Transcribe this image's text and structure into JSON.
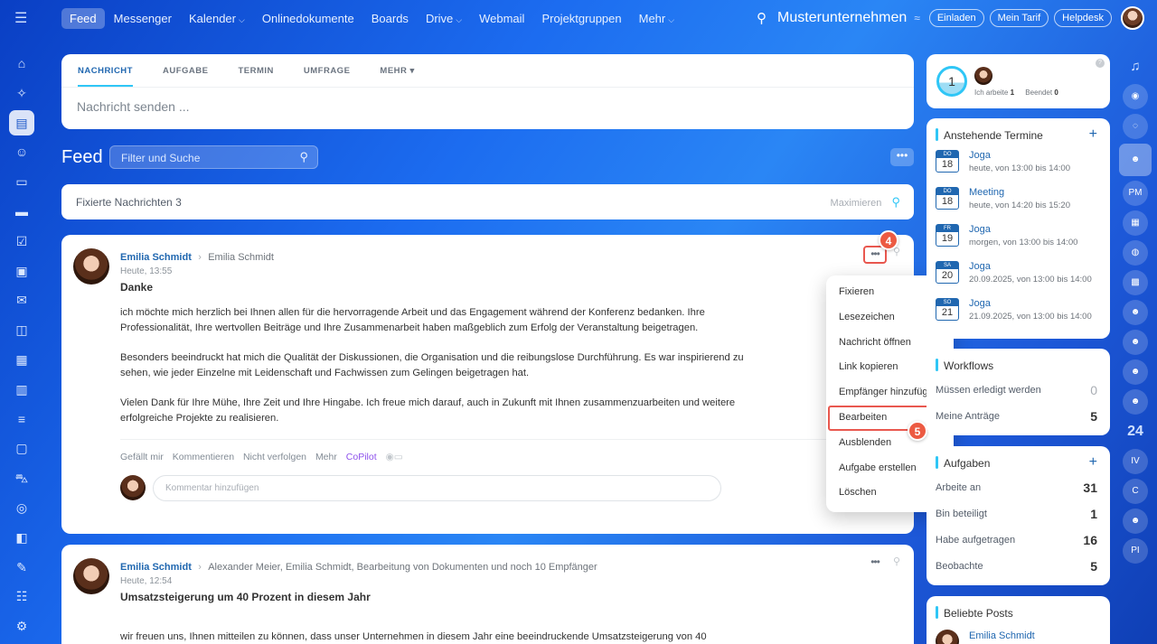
{
  "topbar": {
    "nav": [
      {
        "label": "Feed",
        "active": true,
        "caret": false
      },
      {
        "label": "Messenger",
        "active": false,
        "caret": false
      },
      {
        "label": "Kalender",
        "active": false,
        "caret": true
      },
      {
        "label": "Onlinedokumente",
        "active": false,
        "caret": false
      },
      {
        "label": "Boards",
        "active": false,
        "caret": false
      },
      {
        "label": "Drive",
        "active": false,
        "caret": true
      },
      {
        "label": "Webmail",
        "active": false,
        "caret": false
      },
      {
        "label": "Projektgruppen",
        "active": false,
        "caret": false
      },
      {
        "label": "Mehr",
        "active": false,
        "caret": true
      }
    ],
    "company": "Musterunternehmen",
    "buttons": {
      "invite": "Einladen",
      "plan": "Mein Tarif",
      "help": "Helpdesk"
    }
  },
  "composer": {
    "tabs": [
      "NACHRICHT",
      "AUFGABE",
      "TERMIN",
      "UMFRAGE",
      "MEHR"
    ],
    "placeholder": "Nachricht senden ..."
  },
  "feed": {
    "title": "Feed",
    "filter_placeholder": "Filter und Suche",
    "pinned": {
      "label": "Fixierte Nachrichten",
      "count": "3",
      "maximize": "Maximieren"
    }
  },
  "post1": {
    "author": "Emilia Schmidt",
    "recipients": "Emilia Schmidt",
    "time": "Heute, 13:55",
    "title": "Danke",
    "paragraphs": [
      "ich möchte mich herzlich bei Ihnen allen für die hervorragende Arbeit und das Engagement während der Konferenz bedanken. Ihre Professionalität, Ihre wertvollen Beiträge und Ihre Zusammenarbeit haben maßgeblich zum Erfolg der Veranstaltung beigetragen.",
      "Besonders beeindruckt hat mich die Qualität der Diskussionen, die Organisation und die reibungslose Durchführung. Es war inspirierend zu sehen, wie jeder Einzelne mit Leidenschaft und Fachwissen zum Gelingen beigetragen hat.",
      "Vielen Dank für Ihre Mühe, Ihre Zeit und Ihre Hingabe. Ich freue mich darauf, auch in Zukunft mit Ihnen zusammenzuarbeiten und weitere erfolgreiche Projekte zu realisieren."
    ],
    "actions": {
      "like": "Gefällt mir",
      "comment": "Kommentieren",
      "unfollow": "Nicht verfolgen",
      "more": "Mehr",
      "copilot": "CoPilot"
    },
    "comment_placeholder": "Kommentar hinzufügen"
  },
  "post2": {
    "author": "Emilia Schmidt",
    "recipients": "Alexander Meier, Emilia Schmidt, Bearbeitung von Dokumenten  und noch 10 Empfänger",
    "time": "Heute, 12:54",
    "title": "Umsatzsteigerung um 40 Prozent in diesem Jahr",
    "body_start": "wir freuen uns, Ihnen mitteilen zu können, dass unser Unternehmen in diesem Jahr eine beeindruckende Umsatzsteigerung von 40"
  },
  "badges": {
    "step4": "4",
    "step5": "5"
  },
  "context_menu": [
    "Fixieren",
    "Lesezeichen",
    "Nachricht öffnen",
    "Link kopieren",
    "Empfänger hinzufügen",
    "Bearbeiten",
    "Ausblenden",
    "Aufgabe erstellen",
    "Löschen"
  ],
  "work_widget": {
    "count": "1",
    "working_label": "Ich arbeite",
    "working_value": "1",
    "done_label": "Beendet",
    "done_value": "0"
  },
  "events_widget": {
    "title": "Anstehende Termine",
    "events": [
      {
        "weekday": "DO",
        "day": "18",
        "title": "Joga",
        "time": "heute, von 13:00 bis 14:00"
      },
      {
        "weekday": "DO",
        "day": "18",
        "title": "Meeting",
        "time": "heute, von 14:20 bis 15:20"
      },
      {
        "weekday": "FR",
        "day": "19",
        "title": "Joga",
        "time": "morgen, von 13:00 bis 14:00"
      },
      {
        "weekday": "SA",
        "day": "20",
        "title": "Joga",
        "time": "20.09.2025, von 13:00 bis 14:00"
      },
      {
        "weekday": "SO",
        "day": "21",
        "title": "Joga",
        "time": "21.09.2025, von 13:00 bis 14:00"
      }
    ]
  },
  "workflows_widget": {
    "title": "Workflows",
    "rows": [
      {
        "label": "Müssen erledigt werden",
        "value": "0"
      },
      {
        "label": "Meine Anträge",
        "value": "5"
      }
    ]
  },
  "tasks_widget": {
    "title": "Aufgaben",
    "rows": [
      {
        "label": "Arbeite an",
        "value": "31"
      },
      {
        "label": "Bin beteiligt",
        "value": "1"
      },
      {
        "label": "Habe aufgetragen",
        "value": "16"
      },
      {
        "label": "Beobachte",
        "value": "5"
      }
    ]
  },
  "posts_widget": {
    "title": "Beliebte Posts",
    "author": "Emilia Schmidt"
  },
  "rightbar": {
    "counter": "24",
    "initials": [
      "PM",
      "IV",
      "C",
      "PI"
    ]
  }
}
